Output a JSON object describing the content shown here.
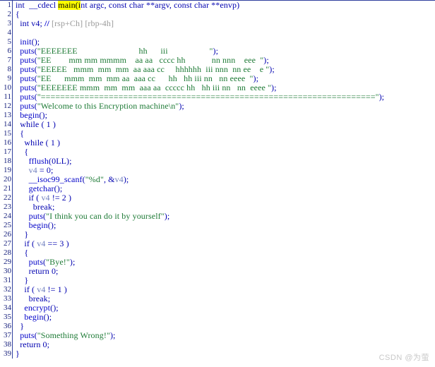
{
  "view": {
    "name": "pseudocode-view",
    "accent_color": "#2f3f9e",
    "background": "#ffffff",
    "gutter_color": "#1a237e",
    "string_color": "#1d7a35",
    "keyword_color": "#0000b0",
    "comment_color": "#9a9a9a",
    "highlight_color": "#ffff00",
    "variable_color": "#6f7fbf"
  },
  "watermark": "CSDN @为萤",
  "code": {
    "lines": [
      {
        "n": "1",
        "segments": [
          {
            "t": "kw",
            "s": "int  __cdecl "
          },
          {
            "t": "hl",
            "s": "main(i"
          },
          {
            "t": "kw",
            "s": "nt argc, const char **argv, const char **envp)"
          }
        ]
      },
      {
        "n": "2",
        "segments": [
          {
            "t": "kw",
            "s": "{"
          }
        ]
      },
      {
        "n": "3",
        "segments": [
          {
            "t": "kw",
            "s": "  int v4; "
          },
          {
            "t": "cmtmark",
            "s": "// "
          },
          {
            "t": "cmt",
            "s": "[rsp+Ch] [rbp-4h]"
          }
        ]
      },
      {
        "n": "4",
        "segments": [
          {
            "t": "kw",
            "s": ""
          }
        ]
      },
      {
        "n": "5",
        "segments": [
          {
            "t": "kw",
            "s": "  "
          },
          {
            "t": "fn",
            "s": "init"
          },
          {
            "t": "kw",
            "s": "();"
          }
        ]
      },
      {
        "n": "6",
        "segments": [
          {
            "t": "kw",
            "s": "  "
          },
          {
            "t": "fn",
            "s": "puts"
          },
          {
            "t": "kw",
            "s": "("
          },
          {
            "t": "str",
            "s": "\"EEEEEEE                            hh      iii                   \""
          },
          {
            "t": "kw",
            "s": ");"
          }
        ]
      },
      {
        "n": "7",
        "segments": [
          {
            "t": "kw",
            "s": "  "
          },
          {
            "t": "fn",
            "s": "puts"
          },
          {
            "t": "kw",
            "s": "("
          },
          {
            "t": "str",
            "s": "\"EE        mm mm mmmm    aa aa   cccc hh            nn nnn    eee  \""
          },
          {
            "t": "kw",
            "s": ");"
          }
        ]
      },
      {
        "n": "8",
        "segments": [
          {
            "t": "kw",
            "s": "  "
          },
          {
            "t": "fn",
            "s": "puts"
          },
          {
            "t": "kw",
            "s": "("
          },
          {
            "t": "str",
            "s": "\"EEEEE   mmm  mm  mm  aa aaa cc     hhhhhh  iii nnn  nn ee    e \""
          },
          {
            "t": "kw",
            "s": ");"
          }
        ]
      },
      {
        "n": "9",
        "segments": [
          {
            "t": "kw",
            "s": "  "
          },
          {
            "t": "fn",
            "s": "puts"
          },
          {
            "t": "kw",
            "s": "("
          },
          {
            "t": "str",
            "s": "\"EE      mmm  mm  mm aa  aaa cc      hh   hh iii nn   nn eeee  \""
          },
          {
            "t": "kw",
            "s": ");"
          }
        ]
      },
      {
        "n": "10",
        "segments": [
          {
            "t": "kw",
            "s": "  "
          },
          {
            "t": "fn",
            "s": "puts"
          },
          {
            "t": "kw",
            "s": "("
          },
          {
            "t": "str",
            "s": "\"EEEEEEE mmm  mm  mm  aaa aa  ccccc hh   hh iii nn   nn  eeee \""
          },
          {
            "t": "kw",
            "s": ");"
          }
        ]
      },
      {
        "n": "11",
        "segments": [
          {
            "t": "kw",
            "s": "  "
          },
          {
            "t": "fn",
            "s": "puts"
          },
          {
            "t": "kw",
            "s": "("
          },
          {
            "t": "str",
            "s": "\"=====================================================================\""
          },
          {
            "t": "kw",
            "s": ");"
          }
        ]
      },
      {
        "n": "12",
        "segments": [
          {
            "t": "kw",
            "s": "  "
          },
          {
            "t": "fn",
            "s": "puts"
          },
          {
            "t": "kw",
            "s": "("
          },
          {
            "t": "str",
            "s": "\"Welcome to this Encryption machine\\n\""
          },
          {
            "t": "kw",
            "s": ");"
          }
        ]
      },
      {
        "n": "13",
        "segments": [
          {
            "t": "kw",
            "s": "  "
          },
          {
            "t": "fn",
            "s": "begin"
          },
          {
            "t": "kw",
            "s": "();"
          }
        ]
      },
      {
        "n": "14",
        "segments": [
          {
            "t": "kw",
            "s": "  while ( 1 )"
          }
        ]
      },
      {
        "n": "15",
        "segments": [
          {
            "t": "kw",
            "s": "  {"
          }
        ]
      },
      {
        "n": "16",
        "segments": [
          {
            "t": "kw",
            "s": "    while ( 1 )"
          }
        ]
      },
      {
        "n": "17",
        "segments": [
          {
            "t": "kw",
            "s": "    {"
          }
        ]
      },
      {
        "n": "18",
        "segments": [
          {
            "t": "kw",
            "s": "      "
          },
          {
            "t": "fn",
            "s": "fflush"
          },
          {
            "t": "kw",
            "s": "(0LL);"
          }
        ]
      },
      {
        "n": "19",
        "segments": [
          {
            "t": "kw",
            "s": "      "
          },
          {
            "t": "var",
            "s": "v4"
          },
          {
            "t": "kw",
            "s": " = 0;"
          }
        ]
      },
      {
        "n": "20",
        "segments": [
          {
            "t": "kw",
            "s": "      "
          },
          {
            "t": "fn",
            "s": "__isoc99_scanf"
          },
          {
            "t": "kw",
            "s": "("
          },
          {
            "t": "str",
            "s": "\"%d\""
          },
          {
            "t": "kw",
            "s": ", &"
          },
          {
            "t": "var",
            "s": "v4"
          },
          {
            "t": "kw",
            "s": ");"
          }
        ]
      },
      {
        "n": "21",
        "segments": [
          {
            "t": "kw",
            "s": "      "
          },
          {
            "t": "fn",
            "s": "getchar"
          },
          {
            "t": "kw",
            "s": "();"
          }
        ]
      },
      {
        "n": "22",
        "segments": [
          {
            "t": "kw",
            "s": "      if ( "
          },
          {
            "t": "var",
            "s": "v4"
          },
          {
            "t": "kw",
            "s": " != 2 )"
          }
        ]
      },
      {
        "n": "23",
        "segments": [
          {
            "t": "kw",
            "s": "        break;"
          }
        ]
      },
      {
        "n": "24",
        "segments": [
          {
            "t": "kw",
            "s": "      "
          },
          {
            "t": "fn",
            "s": "puts"
          },
          {
            "t": "kw",
            "s": "("
          },
          {
            "t": "str",
            "s": "\"I think you can do it by yourself\""
          },
          {
            "t": "kw",
            "s": ");"
          }
        ]
      },
      {
        "n": "25",
        "segments": [
          {
            "t": "kw",
            "s": "      "
          },
          {
            "t": "fn",
            "s": "begin"
          },
          {
            "t": "kw",
            "s": "();"
          }
        ]
      },
      {
        "n": "26",
        "segments": [
          {
            "t": "kw",
            "s": "    }"
          }
        ]
      },
      {
        "n": "27",
        "segments": [
          {
            "t": "kw",
            "s": "    if ( "
          },
          {
            "t": "var",
            "s": "v4"
          },
          {
            "t": "kw",
            "s": " == 3 )"
          }
        ]
      },
      {
        "n": "28",
        "segments": [
          {
            "t": "kw",
            "s": "    {"
          }
        ]
      },
      {
        "n": "29",
        "segments": [
          {
            "t": "kw",
            "s": "      "
          },
          {
            "t": "fn",
            "s": "puts"
          },
          {
            "t": "kw",
            "s": "("
          },
          {
            "t": "str",
            "s": "\"Bye!\""
          },
          {
            "t": "kw",
            "s": ");"
          }
        ]
      },
      {
        "n": "30",
        "segments": [
          {
            "t": "kw",
            "s": "      return 0;"
          }
        ]
      },
      {
        "n": "31",
        "segments": [
          {
            "t": "kw",
            "s": "    }"
          }
        ]
      },
      {
        "n": "32",
        "segments": [
          {
            "t": "kw",
            "s": "    if ( "
          },
          {
            "t": "var",
            "s": "v4"
          },
          {
            "t": "kw",
            "s": " != 1 )"
          }
        ]
      },
      {
        "n": "33",
        "segments": [
          {
            "t": "kw",
            "s": "      break;"
          }
        ]
      },
      {
        "n": "34",
        "segments": [
          {
            "t": "kw",
            "s": "    "
          },
          {
            "t": "fn",
            "s": "encrypt"
          },
          {
            "t": "kw",
            "s": "();"
          }
        ]
      },
      {
        "n": "35",
        "segments": [
          {
            "t": "kw",
            "s": "    "
          },
          {
            "t": "fn",
            "s": "begin"
          },
          {
            "t": "kw",
            "s": "();"
          }
        ]
      },
      {
        "n": "36",
        "segments": [
          {
            "t": "kw",
            "s": "  }"
          }
        ]
      },
      {
        "n": "37",
        "segments": [
          {
            "t": "kw",
            "s": "  "
          },
          {
            "t": "fn",
            "s": "puts"
          },
          {
            "t": "kw",
            "s": "("
          },
          {
            "t": "str",
            "s": "\"Something Wrong!\""
          },
          {
            "t": "kw",
            "s": ");"
          }
        ]
      },
      {
        "n": "38",
        "segments": [
          {
            "t": "kw",
            "s": "  return 0;"
          }
        ]
      },
      {
        "n": "39",
        "segments": [
          {
            "t": "kw",
            "s": "}"
          }
        ]
      }
    ]
  }
}
